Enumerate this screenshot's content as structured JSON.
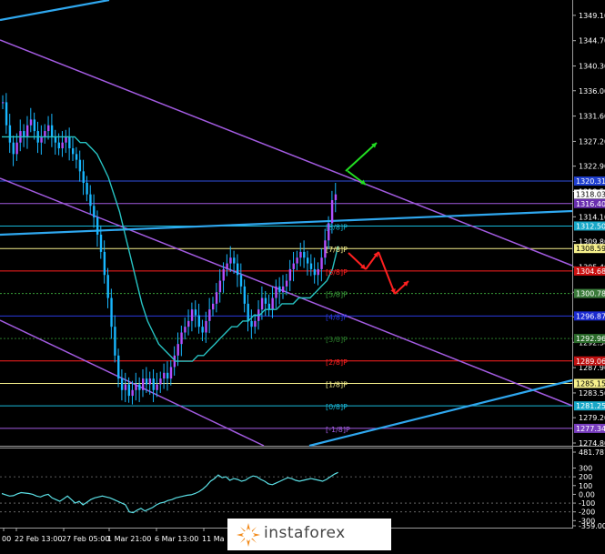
{
  "colors": {
    "bg": "#000000",
    "candle": "#18b7ff",
    "candle_up_accent": "#b050ff",
    "ma": "#27c3c3",
    "channel": "#a25be0",
    "trend": "#2fa7ee",
    "arrow_up": "#22dd22",
    "arrow_down": "#ff2020",
    "axis_text": "#ffffff",
    "osc": "#5be0e6"
  },
  "price_axis": {
    "ymin": 1274.8,
    "ymax": 1350.5,
    "ticks": [
      "1349.10",
      "1344.70",
      "1340.30",
      "1336.00",
      "1331.60",
      "1327.20",
      "1322.90",
      "1318.50",
      "1314.10",
      "1309.80",
      "1305.40",
      "1301.00",
      "1296.70",
      "1292.30",
      "1287.90",
      "1283.50",
      "1279.20",
      "1274.80"
    ]
  },
  "price_labels": [
    {
      "text": "1318.03",
      "value": 1318.03,
      "bg": "#ffffff",
      "fg": "#000000"
    },
    {
      "text": "1316.40",
      "value": 1316.4,
      "bg": "#6a2fb0",
      "fg": "#ffffff"
    },
    {
      "text": "1320.31",
      "value": 1320.31,
      "bg": "#1f3fcf",
      "fg": "#ffffff"
    },
    {
      "text": "1312.50",
      "value": 1312.5,
      "bg": "#18a8c8",
      "fg": "#ffffff"
    },
    {
      "text": "1308.59",
      "value": 1308.59,
      "bg": "#f6f08c",
      "fg": "#000000"
    },
    {
      "text": "1304.68",
      "value": 1304.68,
      "bg": "#cc1010",
      "fg": "#ffffff"
    },
    {
      "text": "1300.78",
      "value": 1300.78,
      "bg": "#3a7a3a",
      "fg": "#ffffff"
    },
    {
      "text": "1296.87",
      "value": 1296.87,
      "bg": "#1a2ad0",
      "fg": "#ffffff"
    },
    {
      "text": "1292.96",
      "value": 1292.96,
      "bg": "#2a6a2a",
      "fg": "#ffffff"
    },
    {
      "text": "1289.06",
      "value": 1289.06,
      "bg": "#c01010",
      "fg": "#ffffff"
    },
    {
      "text": "1285.15",
      "value": 1285.15,
      "bg": "#f6f08c",
      "fg": "#000000"
    },
    {
      "text": "1281.25",
      "value": 1281.25,
      "bg": "#18a8c8",
      "fg": "#ffffff"
    },
    {
      "text": "1277.34",
      "value": 1277.34,
      "bg": "#7a3fc0",
      "fg": "#ffffff"
    }
  ],
  "murrey": [
    {
      "label": "[8/8]P",
      "value": 1312.5,
      "color": "#18b8d8",
      "dash": false
    },
    {
      "label": "[7/8]P",
      "value": 1308.59,
      "color": "#f6f08c",
      "dash": false
    },
    {
      "label": "[6/8]P",
      "value": 1304.68,
      "color": "#ff2020",
      "dash": false
    },
    {
      "label": "[5/8]P",
      "value": 1300.78,
      "color": "#3aa03a",
      "dash": true
    },
    {
      "label": "[4/8]P",
      "value": 1296.87,
      "color": "#2a3ae0",
      "dash": false
    },
    {
      "label": "[3/8]P",
      "value": 1292.96,
      "color": "#2a7a2a",
      "dash": true
    },
    {
      "label": "[2/8]P",
      "value": 1289.06,
      "color": "#ff2020",
      "dash": false
    },
    {
      "label": "[1/8]P",
      "value": 1285.15,
      "color": "#f6f08c",
      "dash": false
    },
    {
      "label": "[0/8]P",
      "value": 1281.25,
      "color": "#18b8d8",
      "dash": false
    },
    {
      "label": "[-1/8]P",
      "value": 1277.34,
      "color": "#a25be0",
      "dash": false
    },
    {
      "label": "",
      "value": 1320.31,
      "color": "#3050e0",
      "dash": false
    },
    {
      "label": "",
      "value": 1316.4,
      "color": "#a25be0",
      "dash": false
    }
  ],
  "x_axis": {
    "labels": [
      "00",
      "22 Feb 13:00",
      "27 Feb 05:00",
      "1 Mar 21:00",
      "6 Mar 13:00",
      "11 Ma"
    ]
  },
  "osc_axis": {
    "ymin": -359.0,
    "ymax": 481.8,
    "ticks": [
      "481.7813",
      "300",
      "200",
      "100",
      "0.00",
      "-100",
      "-200",
      "-300",
      "-359.0001"
    ]
  },
  "chart_data": {
    "type": "candlestick",
    "bars": 112,
    "closes": [
      1334,
      1330,
      1327,
      1325,
      1327,
      1329,
      1328,
      1330,
      1331,
      1329,
      1327,
      1328,
      1329,
      1330,
      1328,
      1327,
      1326,
      1327,
      1328,
      1326,
      1325,
      1324,
      1322,
      1320,
      1318,
      1316,
      1314,
      1311,
      1308,
      1304,
      1300,
      1295,
      1290,
      1286,
      1284,
      1285,
      1283,
      1284,
      1285,
      1284,
      1286,
      1285,
      1286,
      1284,
      1285,
      1286,
      1287,
      1286,
      1288,
      1290,
      1292,
      1294,
      1295,
      1296,
      1298,
      1297,
      1295,
      1294,
      1296,
      1298,
      1299,
      1301,
      1303,
      1305,
      1306,
      1307,
      1306,
      1304,
      1302,
      1299,
      1296,
      1295,
      1296,
      1298,
      1300,
      1299,
      1298,
      1300,
      1302,
      1301,
      1302,
      1303,
      1305,
      1306,
      1307,
      1308,
      1307,
      1306,
      1305,
      1304,
      1305,
      1307,
      1310,
      1313,
      1317,
      1318
    ],
    "ma": [
      1328,
      1328,
      1328,
      1328,
      1328,
      1328,
      1328,
      1328,
      1328,
      1328,
      1328,
      1328,
      1328,
      1328,
      1327,
      1327,
      1326,
      1325,
      1323,
      1321,
      1318,
      1315,
      1311,
      1307,
      1303,
      1299,
      1296,
      1294,
      1292,
      1291,
      1290,
      1289,
      1289,
      1289,
      1289,
      1290,
      1290,
      1291,
      1292,
      1293,
      1294,
      1295,
      1295,
      1296,
      1296,
      1297,
      1297,
      1298,
      1298,
      1298,
      1299,
      1299,
      1299,
      1300,
      1300,
      1300,
      1301,
      1302,
      1303,
      1305,
      1309
    ],
    "oscillator": [
      10,
      -5,
      -20,
      -15,
      5,
      20,
      15,
      10,
      0,
      -20,
      -30,
      -10,
      0,
      -40,
      -60,
      -80,
      -50,
      -20,
      -60,
      -100,
      -80,
      -120,
      -90,
      -60,
      -40,
      -30,
      -20,
      -30,
      -40,
      -60,
      -80,
      -100,
      -120,
      -200,
      -210,
      -180,
      -160,
      -190,
      -170,
      -150,
      -120,
      -100,
      -90,
      -70,
      -60,
      -40,
      -30,
      -20,
      -10,
      -5,
      10,
      30,
      60,
      100,
      150,
      180,
      220,
      190,
      200,
      160,
      180,
      170,
      150,
      160,
      190,
      210,
      200,
      170,
      150,
      120,
      110,
      130,
      150,
      170,
      190,
      180,
      160,
      150,
      160,
      170,
      180,
      170,
      160,
      150,
      170,
      200,
      230,
      250
    ]
  }
}
